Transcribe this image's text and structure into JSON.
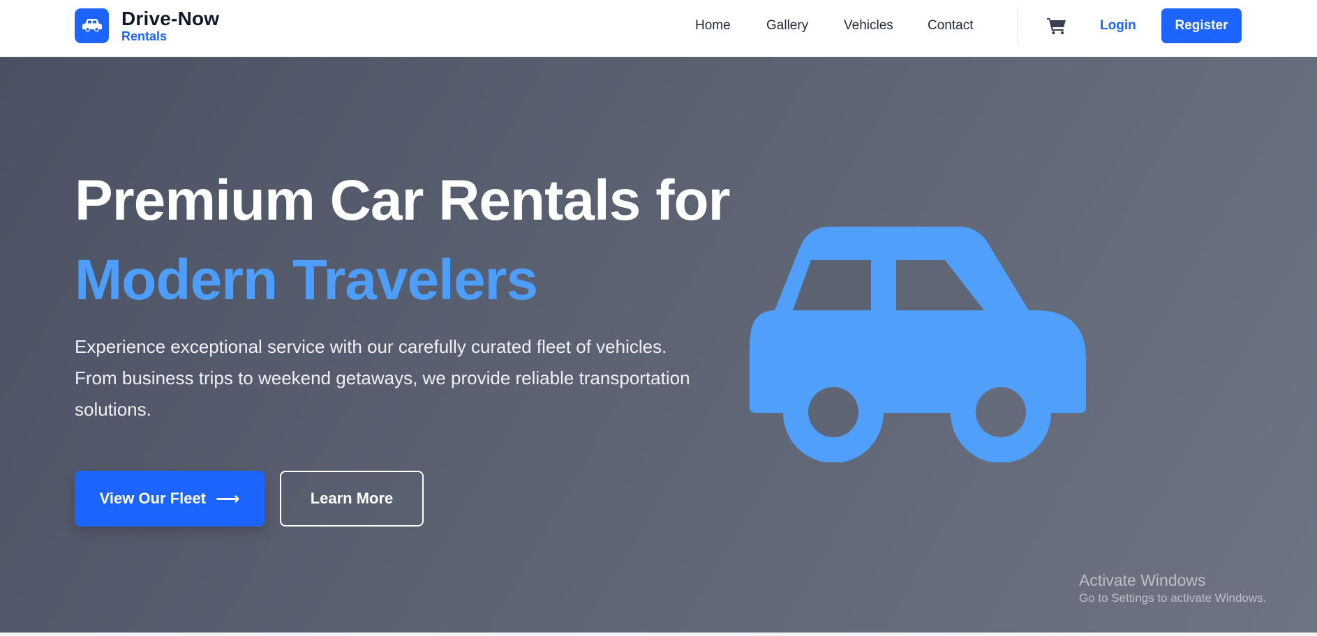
{
  "brand": {
    "name": "Drive-Now",
    "tagline": "Rentals",
    "accent": "#1d64ff",
    "icon": "car-icon"
  },
  "nav": {
    "links": [
      "Home",
      "Gallery",
      "Vehicles",
      "Contact"
    ],
    "cart_icon": "cart-icon",
    "login": "Login",
    "register": "Register"
  },
  "hero": {
    "title_line1": "Premium Car Rentals for",
    "title_line2": "Modern Travelers",
    "title_line2_color": "#4d9dfa",
    "description": "Experience exceptional service with our carefully curated fleet of vehicles. From business trips to weekend getaways, we provide reliable transportation solutions.",
    "primary_cta": "View Our Fleet",
    "primary_cta_icon": "arrow-right-icon",
    "secondary_cta": "Learn More",
    "illustration_icon": "car-icon"
  },
  "os_watermark": {
    "line1": "Activate Windows",
    "line2": "Go to Settings to activate Windows."
  }
}
